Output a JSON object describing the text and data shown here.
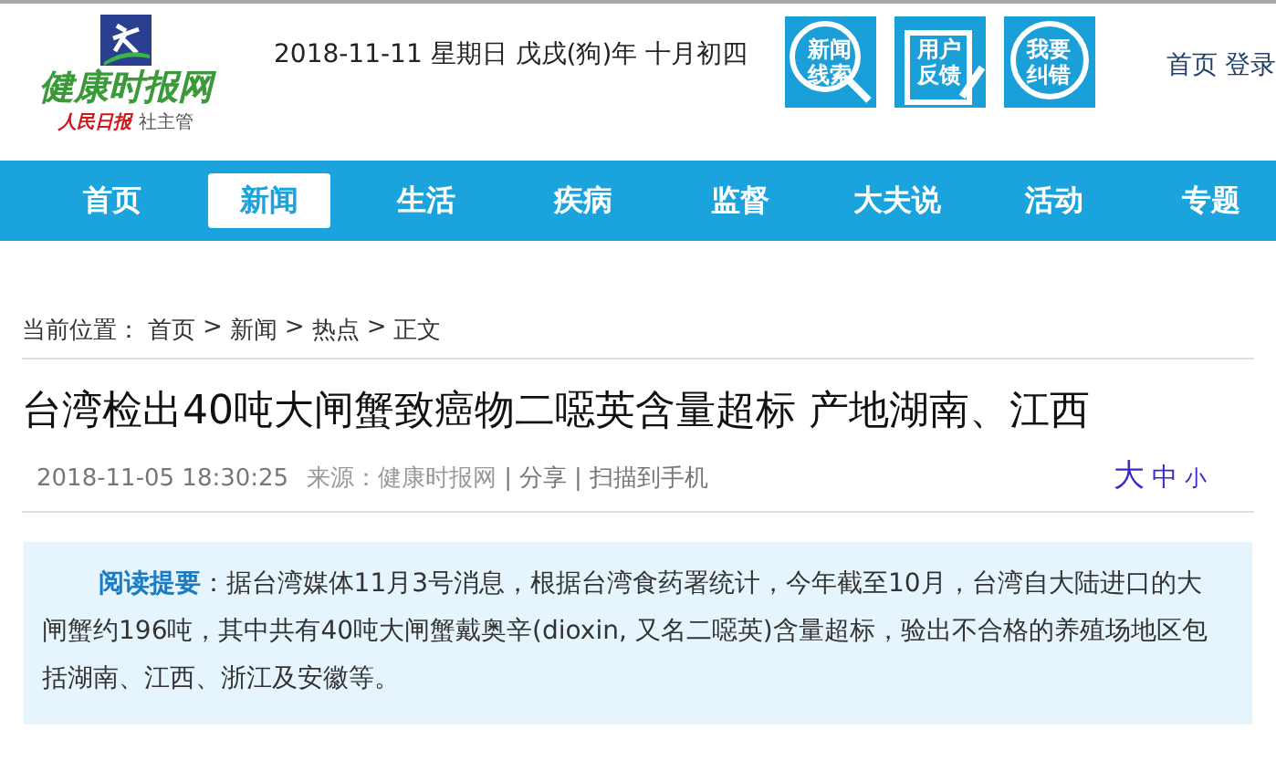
{
  "header": {
    "logo": {
      "name": "健康时报网",
      "publisher": "人民日报",
      "publisher_suffix": "社主管"
    },
    "date": "2018-11-11 星期日 戊戌(狗)年 十月初四",
    "quick_links": [
      {
        "line1": "新闻",
        "line2": "线索",
        "kind": "search"
      },
      {
        "line1": "用户",
        "line2": "反馈",
        "kind": "clipboard"
      },
      {
        "line1": "我要",
        "line2": "纠错",
        "kind": "bubble"
      }
    ],
    "top_links": [
      "首页",
      "登录"
    ]
  },
  "nav": [
    {
      "label": "首页",
      "selected": false
    },
    {
      "label": "新闻",
      "selected": true
    },
    {
      "label": "生活",
      "selected": false
    },
    {
      "label": "疾病",
      "selected": false
    },
    {
      "label": "监督",
      "selected": false
    },
    {
      "label": "大夫说",
      "selected": false
    },
    {
      "label": "活动",
      "selected": false
    },
    {
      "label": "专题",
      "selected": false
    }
  ],
  "breadcrumb": {
    "prefix": "当前位置：",
    "items": [
      "首页",
      "新闻",
      "热点",
      "正文"
    ],
    "separators": [
      ">",
      ">",
      ">"
    ]
  },
  "article": {
    "title": "台湾检出40吨大闸蟹致癌物二噁英含量超标 产地湖南、江西",
    "datetime": "2018-11-05 18:30:25",
    "source": "来源：健康时报网",
    "actions": [
      "分享",
      "扫描到手机"
    ],
    "action_separators": [
      "|",
      "|"
    ],
    "font_sizes": [
      {
        "label": "大",
        "kind": "large"
      },
      {
        "label": "中",
        "kind": "medium"
      },
      {
        "label": "小",
        "kind": "small"
      }
    ],
    "summary": "**阅读提要**：据台湾媒体11月3号消息，根据台湾食药署统计，今年截至10月，台湾自大陆进口的大闸蟹约196吨，其中共有40吨大闸蟹戴奥辛(dioxin, 又名二噁英)含量超标，验出不合格的养殖场地区包括湖南、江西、浙江及安徽等。"
  }
}
